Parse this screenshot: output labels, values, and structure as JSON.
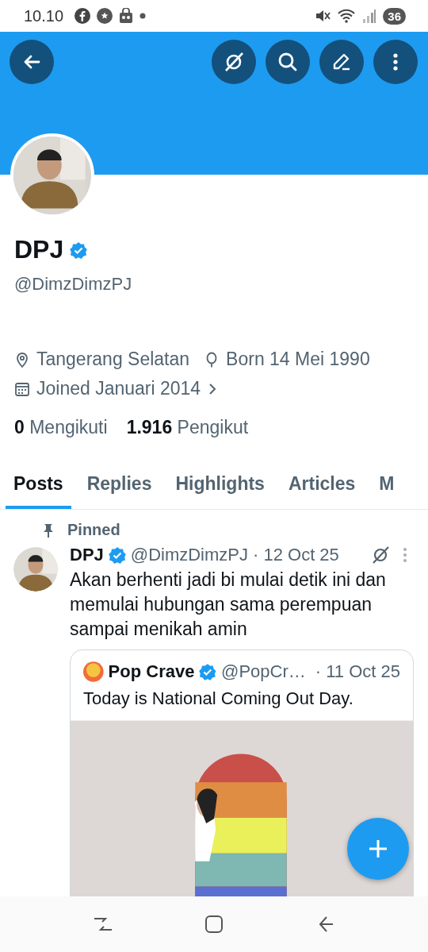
{
  "status_bar": {
    "time": "10.10",
    "battery": "36"
  },
  "header": {
    "buttons": [
      {
        "kind": "back"
      },
      {
        "kind": "grok"
      },
      {
        "kind": "search"
      },
      {
        "kind": "edit"
      },
      {
        "kind": "more"
      }
    ]
  },
  "profile": {
    "name": "DPJ",
    "verified": true,
    "handle": "@DimzDimzPJ",
    "meta": [
      {
        "kind": "location",
        "text": "Tangerang Selatan"
      },
      {
        "kind": "birthday",
        "text": "Born 14 Mei 1990"
      },
      {
        "kind": "joined",
        "text": "Joined Januari 2014"
      }
    ],
    "stats": [
      {
        "count": "0",
        "label": "Mengikuti"
      },
      {
        "count": "1.916",
        "label": "Pengikut"
      }
    ]
  },
  "tabs": [
    {
      "label": "Posts",
      "selected": true
    },
    {
      "label": "Replies",
      "selected": false
    },
    {
      "label": "Highlights",
      "selected": false
    },
    {
      "label": "Articles",
      "selected": false
    },
    {
      "label": "M",
      "selected": false
    }
  ],
  "pinned_post": {
    "label": "Pinned",
    "author": "DPJ",
    "verified": true,
    "handle": "@DimzDimzPJ",
    "date": "· 12 Oct 25",
    "text": "Akan berhenti jadi bi mulai detik ini dan memulai hubungan sama perempuan sampai menikah amin",
    "quote": {
      "author": "Pop Crave",
      "verified": true,
      "handle": "@PopCr…",
      "date": "· 11 Oct 25",
      "text": "Today is National Coming Out Day."
    }
  }
}
